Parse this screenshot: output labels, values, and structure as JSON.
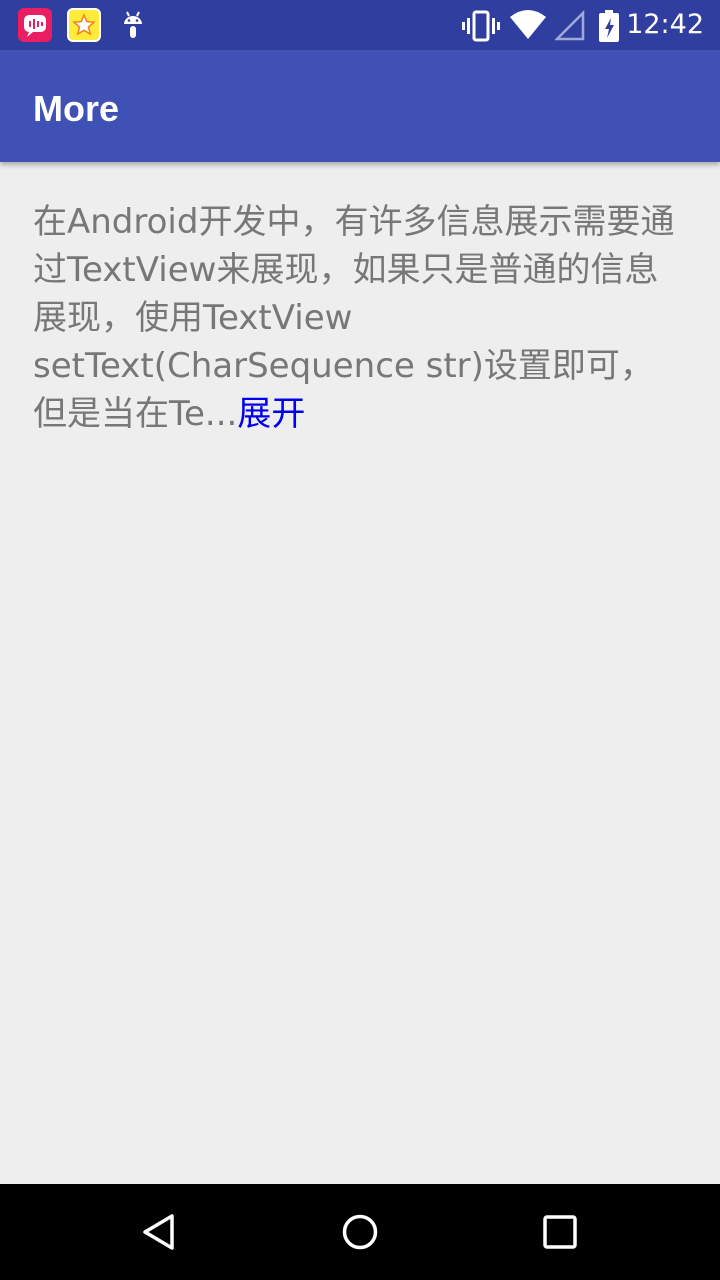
{
  "status_bar": {
    "time": "12:42",
    "notification_icons": [
      "chat-app-icon",
      "star-app-icon",
      "android-debug-icon"
    ],
    "system_icons": [
      "vibrate-icon",
      "wifi-icon",
      "cell-signal-icon",
      "battery-icon"
    ]
  },
  "app_bar": {
    "title": "More"
  },
  "content": {
    "text": "在Android开发中，有许多信息展示需要通过TextView来展现，如果只是普通的信息展现，使用TextView setText(CharSequence str)设置即可，但是当在Te...",
    "expand_label": "展开"
  },
  "nav_bar": {
    "buttons": [
      "back-icon",
      "home-icon",
      "recents-icon"
    ]
  },
  "colors": {
    "status_bar": "#303f9f",
    "app_bar": "#3f51b5",
    "background": "#eeeeee",
    "body_text": "#777777",
    "link": "#0000ee",
    "nav_bar": "#000000"
  }
}
